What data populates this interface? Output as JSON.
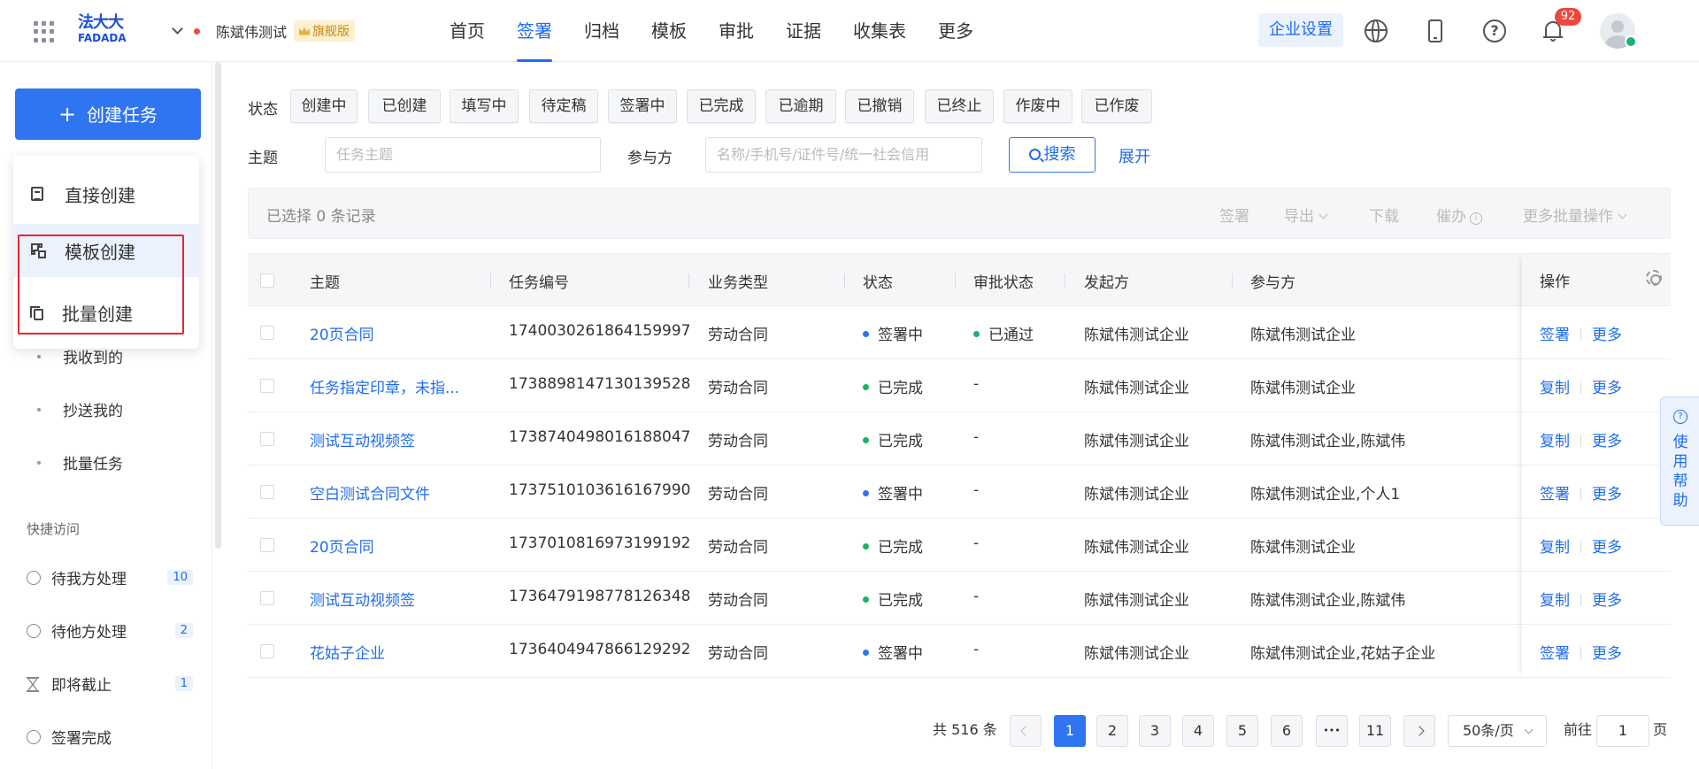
{
  "header": {
    "logo_top": "法大大",
    "logo_bottom": "FADADA",
    "org_name": "陈斌伟测试",
    "edition": "旗舰版",
    "nav": [
      "首页",
      "签署",
      "归档",
      "模板",
      "审批",
      "证据",
      "收集表",
      "更多"
    ],
    "active_nav": "签署",
    "enterprise_settings": "企业设置",
    "notification_count": "92"
  },
  "sidebar": {
    "create_button": "创建任务",
    "dropdown": [
      "直接创建",
      "模板创建",
      "批量创建"
    ],
    "items": [
      "我收到的",
      "抄送我的",
      "批量任务"
    ],
    "quick_access_title": "快捷访问",
    "quick": [
      {
        "label": "待我方处理",
        "count": "10"
      },
      {
        "label": "待他方处理",
        "count": "2"
      },
      {
        "label": "即将截止",
        "count": "1"
      },
      {
        "label": "签署完成"
      }
    ]
  },
  "filters": {
    "status_label": "状态",
    "statuses": [
      "创建中",
      "已创建",
      "填写中",
      "待定稿",
      "签署中",
      "已完成",
      "已逾期",
      "已撤销",
      "已终止",
      "作废中",
      "已作废"
    ],
    "subject_label": "主题",
    "subject_placeholder": "任务主题",
    "party_label": "参与方",
    "party_placeholder": "名称/手机号/证件号/统一社会信用",
    "search_button": "搜索",
    "expand": "展开"
  },
  "batch_bar": {
    "selected": "已选择 0 条记录",
    "actions": [
      "签署",
      "导出",
      "下载",
      "催办",
      "更多批量操作"
    ]
  },
  "table": {
    "headers": [
      "主题",
      "任务编号",
      "业务类型",
      "状态",
      "审批状态",
      "发起方",
      "参与方",
      "操作"
    ],
    "rows": [
      {
        "subject": "20页合同",
        "id": "1740030261864159997",
        "type": "劳动合同",
        "status": "签署中",
        "approval": "已通过",
        "initiator": "陈斌伟测试企业",
        "party": "陈斌伟测试企业",
        "op1": "签署",
        "op2": "更多"
      },
      {
        "subject": "任务指定印章，未指...",
        "id": "1738898147130139528",
        "type": "劳动合同",
        "status": "已完成",
        "approval": "-",
        "initiator": "陈斌伟测试企业",
        "party": "陈斌伟测试企业",
        "op1": "复制",
        "op2": "更多"
      },
      {
        "subject": "测试互动视频签",
        "id": "1738740498016188047",
        "type": "劳动合同",
        "status": "已完成",
        "approval": "-",
        "initiator": "陈斌伟测试企业",
        "party": "陈斌伟测试企业,陈斌伟",
        "op1": "复制",
        "op2": "更多"
      },
      {
        "subject": "空白测试合同文件",
        "id": "1737510103616167990",
        "type": "劳动合同",
        "status": "签署中",
        "approval": "-",
        "initiator": "陈斌伟测试企业",
        "party": "陈斌伟测试企业,个人1",
        "op1": "签署",
        "op2": "更多"
      },
      {
        "subject": "20页合同",
        "id": "1737010816973199192",
        "type": "劳动合同",
        "status": "已完成",
        "approval": "-",
        "initiator": "陈斌伟测试企业",
        "party": "陈斌伟测试企业",
        "op1": "复制",
        "op2": "更多"
      },
      {
        "subject": "测试互动视频签",
        "id": "1736479198778126348",
        "type": "劳动合同",
        "status": "已完成",
        "approval": "-",
        "initiator": "陈斌伟测试企业",
        "party": "陈斌伟测试企业,陈斌伟",
        "op1": "复制",
        "op2": "更多"
      },
      {
        "subject": "花姑子企业",
        "id": "1736404947866129292",
        "type": "劳动合同",
        "status": "签署中",
        "approval": "-",
        "initiator": "陈斌伟测试企业",
        "party": "陈斌伟测试企业,花姑子企业",
        "op1": "签署",
        "op2": "更多"
      }
    ],
    "status_colors": {
      "签署中": "#2f74f0",
      "已完成": "#19b36b",
      "已通过": "#19b36b"
    }
  },
  "pagination": {
    "total": "共 516 条",
    "pages": [
      "1",
      "2",
      "3",
      "4",
      "5",
      "6",
      "•••",
      "11"
    ],
    "current": "1",
    "page_size": "50条/页",
    "goto_label": "前往",
    "goto_value": "1",
    "page_unit": "页"
  },
  "help_tab": "使用帮助"
}
